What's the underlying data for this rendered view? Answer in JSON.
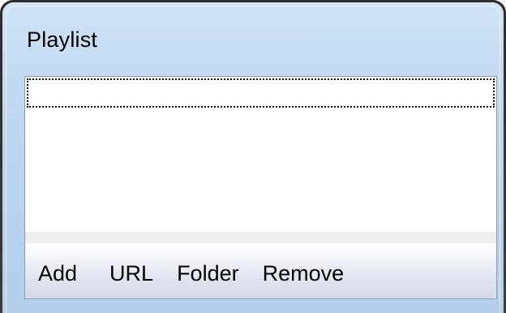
{
  "window": {
    "title": "Playlist"
  },
  "playlist": {
    "items": []
  },
  "toolbar": {
    "add_label": "Add",
    "url_label": "URL",
    "folder_label": "Folder",
    "remove_label": "Remove"
  }
}
